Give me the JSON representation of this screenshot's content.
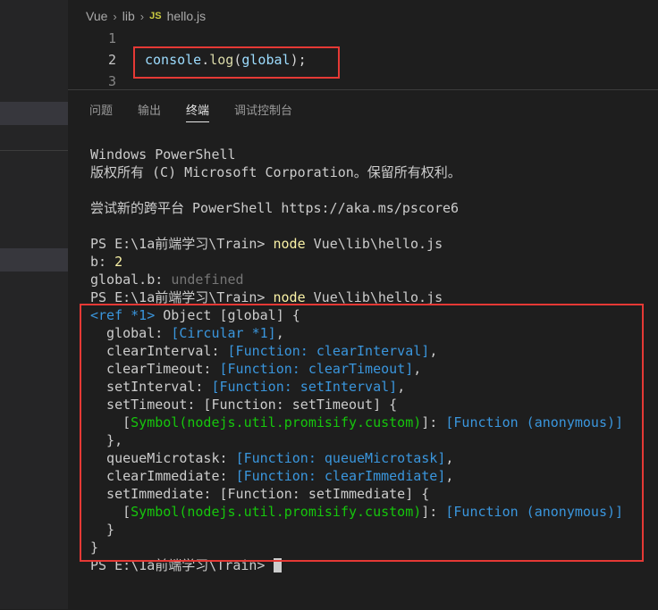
{
  "editor": {
    "breadcrumb": [
      "Vue",
      "lib",
      "hello.js"
    ],
    "breadcrumb_icon": "JS",
    "lines": [
      {
        "num": "1",
        "text": ""
      },
      {
        "num": "2",
        "tokens": [
          "console",
          ".",
          "log",
          "(",
          "global",
          ");"
        ]
      },
      {
        "num": "3",
        "text": ""
      }
    ]
  },
  "panel": {
    "tabs": [
      "问题",
      "输出",
      "终端",
      "调试控制台"
    ],
    "active_tab": "终端"
  },
  "terminal": {
    "line1": "Windows PowerShell",
    "line2": "版权所有 (C) Microsoft Corporation。保留所有权利。",
    "line3": "尝试新的跨平台 PowerShell https://aka.ms/pscore6",
    "prompt": "PS E:\\1a前端学习\\Train> ",
    "cmd": "node",
    "cmd_arg": " Vue\\lib\\hello.js",
    "b_label": "b: ",
    "b_value": "2",
    "global_b_label": "global.b: ",
    "global_b_value": "undefined",
    "obj_ref": "<ref *1>",
    "obj_head": " Object [global] {",
    "k_global": "  global: ",
    "v_global": "[Circular *1]",
    "k_clearInterval": "  clearInterval: ",
    "v_clearInterval": "[Function: clearInterval]",
    "k_clearTimeout": "  clearTimeout: ",
    "v_clearTimeout": "[Function: clearTimeout]",
    "k_setInterval": "  setInterval: ",
    "v_setInterval": "[Function: setInterval]",
    "k_setTimeout": "  setTimeout: [Function: setTimeout] {",
    "symbol": "Symbol(nodejs.util.promisify.custom)",
    "fn_anon": "[Function (anonymous)]",
    "close_inner": "  },",
    "k_queueMicrotask": "  queueMicrotask: ",
    "v_queueMicrotask": "[Function: queueMicrotask]",
    "k_clearImmediate": "  clearImmediate: ",
    "v_clearImmediate": "[Function: clearImmediate]",
    "k_setImmediate": "  setImmediate: [Function: setImmediate] {",
    "close_inner2": "  }",
    "close_outer": "}",
    "final_prompt": "PS E:\\1a前端学习\\Train> "
  }
}
